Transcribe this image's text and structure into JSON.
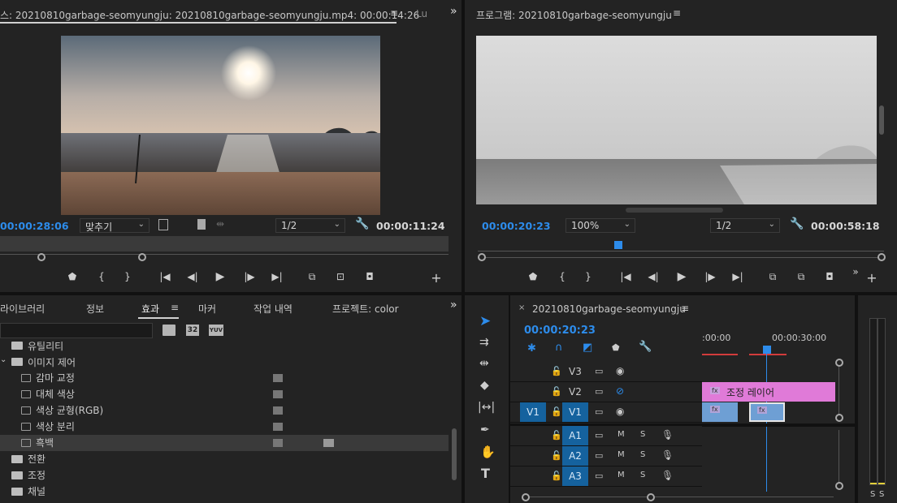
{
  "source_monitor": {
    "tab_title": "스: 20210810garbage-seomyungju: 20210810garbage-seomyungju.mp4: 00:00:14:26",
    "tab_overflow": "Lu",
    "timecode_left": "00:00:28:06",
    "fit_select": "맞추기",
    "resolution_select": "1/2",
    "timecode_right": "00:00:11:24"
  },
  "program_monitor": {
    "tab_title": "프로그램: 20210810garbage-seomyungju",
    "timecode_left": "00:00:20:23",
    "zoom_select": "100%",
    "resolution_select": "1/2",
    "timecode_right": "00:00:58:18"
  },
  "effects_panel": {
    "tabs": [
      "라이브러리",
      "정보",
      "효과",
      "마커",
      "작업 내역",
      "프로젝트: color"
    ],
    "active_tab": "효과",
    "badges": [
      "32",
      "YUV"
    ],
    "tree": [
      {
        "label": "유틸리티",
        "kind": "folder"
      },
      {
        "label": "이미지 제어",
        "kind": "folder-open"
      },
      {
        "label": "감마 교정",
        "kind": "effect"
      },
      {
        "label": "대체 색상",
        "kind": "effect"
      },
      {
        "label": "색상 균형(RGB)",
        "kind": "effect"
      },
      {
        "label": "색상 분리",
        "kind": "effect"
      },
      {
        "label": "흑백",
        "kind": "effect"
      },
      {
        "label": "전환",
        "kind": "folder"
      },
      {
        "label": "조정",
        "kind": "folder"
      },
      {
        "label": "채널",
        "kind": "folder"
      }
    ]
  },
  "timeline": {
    "tab_title": "20210810garbage-seomyungju",
    "timecode": "00:00:20:23",
    "ruler_labels": [
      ":00:00",
      "00:00:30:00"
    ],
    "video_tracks": [
      {
        "name": "V3",
        "source": ""
      },
      {
        "name": "V2",
        "source": ""
      },
      {
        "name": "V1",
        "source": "V1"
      }
    ],
    "audio_tracks": [
      {
        "name": "A1",
        "m": "M",
        "s": "S"
      },
      {
        "name": "A2",
        "m": "M",
        "s": "S"
      },
      {
        "name": "A3",
        "m": "M",
        "s": "S"
      }
    ],
    "adjustment_clip_label": "조정 레이어",
    "fx_label": "fx"
  },
  "audio_meter": {
    "solo_labels": [
      "S",
      "S"
    ]
  }
}
